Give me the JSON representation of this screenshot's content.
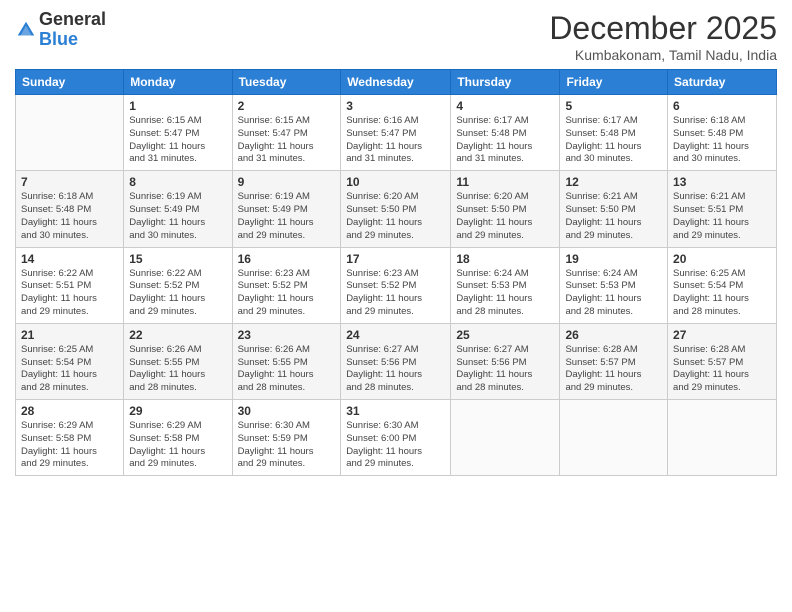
{
  "header": {
    "logo": {
      "line1": "General",
      "line2": "Blue"
    },
    "title": "December 2025",
    "subtitle": "Kumbakonam, Tamil Nadu, India"
  },
  "days": [
    "Sunday",
    "Monday",
    "Tuesday",
    "Wednesday",
    "Thursday",
    "Friday",
    "Saturday"
  ],
  "weeks": [
    [
      {
        "day": "",
        "sunrise": "",
        "sunset": "",
        "daylight": "",
        "empty": true
      },
      {
        "day": "1",
        "sunrise": "Sunrise: 6:15 AM",
        "sunset": "Sunset: 5:47 PM",
        "daylight": "Daylight: 11 hours and 31 minutes."
      },
      {
        "day": "2",
        "sunrise": "Sunrise: 6:15 AM",
        "sunset": "Sunset: 5:47 PM",
        "daylight": "Daylight: 11 hours and 31 minutes."
      },
      {
        "day": "3",
        "sunrise": "Sunrise: 6:16 AM",
        "sunset": "Sunset: 5:47 PM",
        "daylight": "Daylight: 11 hours and 31 minutes."
      },
      {
        "day": "4",
        "sunrise": "Sunrise: 6:17 AM",
        "sunset": "Sunset: 5:48 PM",
        "daylight": "Daylight: 11 hours and 31 minutes."
      },
      {
        "day": "5",
        "sunrise": "Sunrise: 6:17 AM",
        "sunset": "Sunset: 5:48 PM",
        "daylight": "Daylight: 11 hours and 30 minutes."
      },
      {
        "day": "6",
        "sunrise": "Sunrise: 6:18 AM",
        "sunset": "Sunset: 5:48 PM",
        "daylight": "Daylight: 11 hours and 30 minutes."
      }
    ],
    [
      {
        "day": "7",
        "sunrise": "Sunrise: 6:18 AM",
        "sunset": "Sunset: 5:48 PM",
        "daylight": "Daylight: 11 hours and 30 minutes."
      },
      {
        "day": "8",
        "sunrise": "Sunrise: 6:19 AM",
        "sunset": "Sunset: 5:49 PM",
        "daylight": "Daylight: 11 hours and 30 minutes."
      },
      {
        "day": "9",
        "sunrise": "Sunrise: 6:19 AM",
        "sunset": "Sunset: 5:49 PM",
        "daylight": "Daylight: 11 hours and 29 minutes."
      },
      {
        "day": "10",
        "sunrise": "Sunrise: 6:20 AM",
        "sunset": "Sunset: 5:50 PM",
        "daylight": "Daylight: 11 hours and 29 minutes."
      },
      {
        "day": "11",
        "sunrise": "Sunrise: 6:20 AM",
        "sunset": "Sunset: 5:50 PM",
        "daylight": "Daylight: 11 hours and 29 minutes."
      },
      {
        "day": "12",
        "sunrise": "Sunrise: 6:21 AM",
        "sunset": "Sunset: 5:50 PM",
        "daylight": "Daylight: 11 hours and 29 minutes."
      },
      {
        "day": "13",
        "sunrise": "Sunrise: 6:21 AM",
        "sunset": "Sunset: 5:51 PM",
        "daylight": "Daylight: 11 hours and 29 minutes."
      }
    ],
    [
      {
        "day": "14",
        "sunrise": "Sunrise: 6:22 AM",
        "sunset": "Sunset: 5:51 PM",
        "daylight": "Daylight: 11 hours and 29 minutes."
      },
      {
        "day": "15",
        "sunrise": "Sunrise: 6:22 AM",
        "sunset": "Sunset: 5:52 PM",
        "daylight": "Daylight: 11 hours and 29 minutes."
      },
      {
        "day": "16",
        "sunrise": "Sunrise: 6:23 AM",
        "sunset": "Sunset: 5:52 PM",
        "daylight": "Daylight: 11 hours and 29 minutes."
      },
      {
        "day": "17",
        "sunrise": "Sunrise: 6:23 AM",
        "sunset": "Sunset: 5:52 PM",
        "daylight": "Daylight: 11 hours and 29 minutes."
      },
      {
        "day": "18",
        "sunrise": "Sunrise: 6:24 AM",
        "sunset": "Sunset: 5:53 PM",
        "daylight": "Daylight: 11 hours and 28 minutes."
      },
      {
        "day": "19",
        "sunrise": "Sunrise: 6:24 AM",
        "sunset": "Sunset: 5:53 PM",
        "daylight": "Daylight: 11 hours and 28 minutes."
      },
      {
        "day": "20",
        "sunrise": "Sunrise: 6:25 AM",
        "sunset": "Sunset: 5:54 PM",
        "daylight": "Daylight: 11 hours and 28 minutes."
      }
    ],
    [
      {
        "day": "21",
        "sunrise": "Sunrise: 6:25 AM",
        "sunset": "Sunset: 5:54 PM",
        "daylight": "Daylight: 11 hours and 28 minutes."
      },
      {
        "day": "22",
        "sunrise": "Sunrise: 6:26 AM",
        "sunset": "Sunset: 5:55 PM",
        "daylight": "Daylight: 11 hours and 28 minutes."
      },
      {
        "day": "23",
        "sunrise": "Sunrise: 6:26 AM",
        "sunset": "Sunset: 5:55 PM",
        "daylight": "Daylight: 11 hours and 28 minutes."
      },
      {
        "day": "24",
        "sunrise": "Sunrise: 6:27 AM",
        "sunset": "Sunset: 5:56 PM",
        "daylight": "Daylight: 11 hours and 28 minutes."
      },
      {
        "day": "25",
        "sunrise": "Sunrise: 6:27 AM",
        "sunset": "Sunset: 5:56 PM",
        "daylight": "Daylight: 11 hours and 28 minutes."
      },
      {
        "day": "26",
        "sunrise": "Sunrise: 6:28 AM",
        "sunset": "Sunset: 5:57 PM",
        "daylight": "Daylight: 11 hours and 29 minutes."
      },
      {
        "day": "27",
        "sunrise": "Sunrise: 6:28 AM",
        "sunset": "Sunset: 5:57 PM",
        "daylight": "Daylight: 11 hours and 29 minutes."
      }
    ],
    [
      {
        "day": "28",
        "sunrise": "Sunrise: 6:29 AM",
        "sunset": "Sunset: 5:58 PM",
        "daylight": "Daylight: 11 hours and 29 minutes."
      },
      {
        "day": "29",
        "sunrise": "Sunrise: 6:29 AM",
        "sunset": "Sunset: 5:58 PM",
        "daylight": "Daylight: 11 hours and 29 minutes."
      },
      {
        "day": "30",
        "sunrise": "Sunrise: 6:30 AM",
        "sunset": "Sunset: 5:59 PM",
        "daylight": "Daylight: 11 hours and 29 minutes."
      },
      {
        "day": "31",
        "sunrise": "Sunrise: 6:30 AM",
        "sunset": "Sunset: 6:00 PM",
        "daylight": "Daylight: 11 hours and 29 minutes."
      },
      {
        "day": "",
        "sunrise": "",
        "sunset": "",
        "daylight": "",
        "empty": true
      },
      {
        "day": "",
        "sunrise": "",
        "sunset": "",
        "daylight": "",
        "empty": true
      },
      {
        "day": "",
        "sunrise": "",
        "sunset": "",
        "daylight": "",
        "empty": true
      }
    ]
  ]
}
